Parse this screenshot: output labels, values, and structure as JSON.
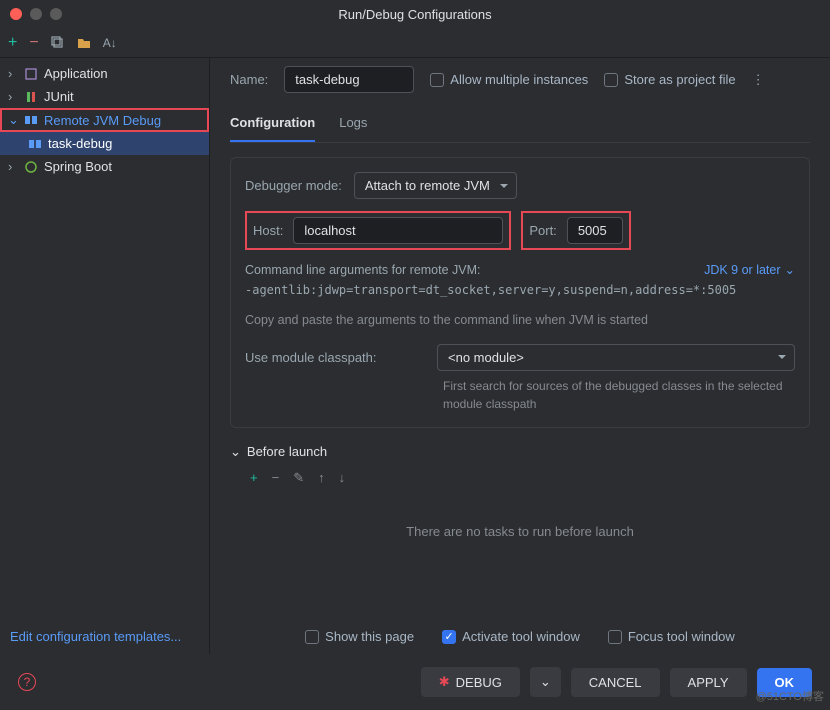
{
  "window": {
    "title": "Run/Debug Configurations"
  },
  "sidebar": {
    "items": [
      {
        "label": "Application",
        "icon": "app-icon",
        "expanded": false
      },
      {
        "label": "JUnit",
        "icon": "junit-icon",
        "expanded": false
      },
      {
        "label": "Remote JVM Debug",
        "icon": "remote-icon",
        "expanded": true,
        "highlighted": true
      },
      {
        "label": "task-debug",
        "icon": "remote-icon",
        "selected": true,
        "indent": 1
      },
      {
        "label": "Spring Boot",
        "icon": "spring-icon",
        "expanded": false
      }
    ],
    "edit_templates": "Edit configuration templates..."
  },
  "form": {
    "name_label": "Name:",
    "name_value": "task-debug",
    "allow_multiple": "Allow multiple instances",
    "store_as_file": "Store as project file"
  },
  "tabs": {
    "configuration": "Configuration",
    "logs": "Logs"
  },
  "config": {
    "debugger_mode_label": "Debugger mode:",
    "debugger_mode_value": "Attach to remote JVM",
    "host_label": "Host:",
    "host_value": "localhost",
    "port_label": "Port:",
    "port_value": "5005",
    "cli_label": "Command line arguments for remote JVM:",
    "jdk_link": "JDK 9 or later",
    "cli_value": "-agentlib:jdwp=transport=dt_socket,server=y,suspend=n,address=*:5005",
    "cli_hint": "Copy and paste the arguments to the command line when JVM is started",
    "module_label": "Use module classpath:",
    "module_value": "<no module>",
    "module_hint": "First search for sources of the debugged classes in the selected module classpath"
  },
  "before_launch": {
    "header": "Before launch",
    "empty": "There are no tasks to run before launch"
  },
  "bottom_checks": {
    "show_page": "Show this page",
    "activate_window": "Activate tool window",
    "focus_window": "Focus tool window"
  },
  "footer": {
    "debug": "DEBUG",
    "cancel": "CANCEL",
    "apply": "APPLY",
    "ok": "OK"
  },
  "watermark": "@51CTO博客"
}
